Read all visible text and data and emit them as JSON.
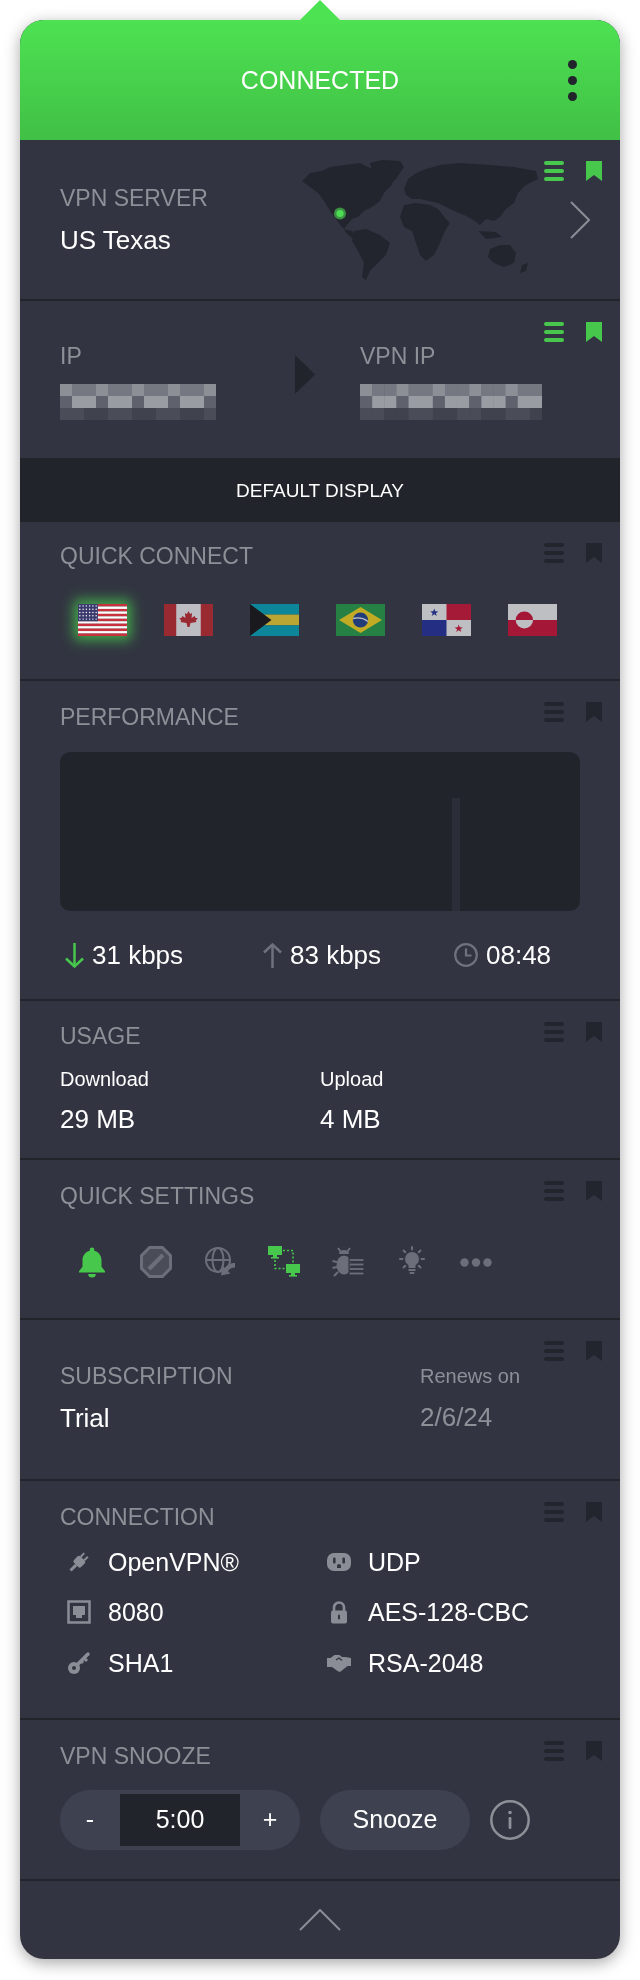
{
  "header": {
    "status": "CONNECTED"
  },
  "vpn_server": {
    "label": "VPN SERVER",
    "value": "US Texas",
    "pinned": true
  },
  "ip_addresses": {
    "pinned": true,
    "local": {
      "label": "IP",
      "masked": true
    },
    "vpn": {
      "label": "VPN IP",
      "masked": true
    }
  },
  "default_display": {
    "label": "DEFAULT DISPLAY"
  },
  "quick_connect": {
    "label": "QUICK CONNECT",
    "pinned": false,
    "flags": [
      {
        "kind": "us",
        "selected": true
      },
      {
        "kind": "ca",
        "selected": false
      },
      {
        "kind": "bs",
        "selected": false
      },
      {
        "kind": "br",
        "selected": false
      },
      {
        "kind": "pa",
        "selected": false
      },
      {
        "kind": "gl",
        "selected": false
      }
    ]
  },
  "performance": {
    "label": "PERFORMANCE",
    "pinned": false,
    "download_rate": "31 kbps",
    "upload_rate": "83 kbps",
    "elapsed": "08:48"
  },
  "usage": {
    "label": "USAGE",
    "pinned": false,
    "columns": [
      {
        "label": "Download",
        "value": "29 MB"
      },
      {
        "label": "Upload",
        "value": "4 MB"
      }
    ]
  },
  "quick_settings": {
    "label": "QUICK SETTINGS",
    "pinned": false,
    "toggles": [
      {
        "kind": "bell",
        "on": true
      },
      {
        "kind": "block",
        "on": false
      },
      {
        "kind": "globe",
        "on": false
      },
      {
        "kind": "network",
        "on": true
      },
      {
        "kind": "bug",
        "on": false
      },
      {
        "kind": "bulb",
        "on": false
      }
    ],
    "more_button": true
  },
  "subscription": {
    "label": "SUBSCRIPTION",
    "pinned": false,
    "plan": "Trial",
    "renews_label": "Renews on",
    "renews_date": "2/6/24"
  },
  "connection": {
    "label": "CONNECTION",
    "pinned": false,
    "items": [
      {
        "kind": "plug",
        "value": "OpenVPN®"
      },
      {
        "kind": "outlet",
        "value": "UDP"
      },
      {
        "kind": "port",
        "value": "8080"
      },
      {
        "kind": "lock",
        "value": "AES-128-CBC"
      },
      {
        "kind": "key",
        "value": "SHA1"
      },
      {
        "kind": "handshake",
        "value": "RSA-2048"
      }
    ]
  },
  "vpn_snooze": {
    "label": "VPN SNOOZE",
    "pinned": false,
    "decrement": "-",
    "duration": "5:00",
    "increment": "+",
    "button": "Snooze"
  }
}
